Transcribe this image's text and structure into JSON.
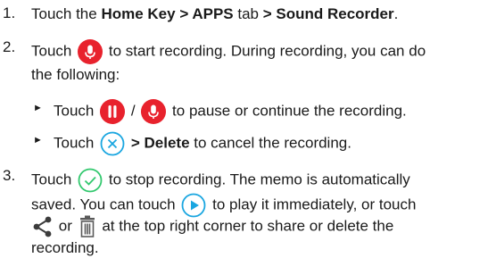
{
  "steps": {
    "s1": {
      "num": "1.",
      "a": "Touch the ",
      "b": "Home Key > APPS",
      "c": " tab ",
      "d": "> Sound Recorder",
      "e": "."
    },
    "s2": {
      "num": "2.",
      "pre": "Touch",
      "post": "to start recording. During recording, you can do",
      "line2": "the following:",
      "sub1": {
        "bullet": "►",
        "pre": "Touch",
        "slash": "/",
        "post": "to pause or continue the recording."
      },
      "sub2": {
        "bullet": "►",
        "pre": "Touch",
        "bold": "> Delete",
        "post": " to cancel the recording."
      }
    },
    "s3": {
      "num": "3.",
      "pre": "Touch",
      "post": "to stop recording. The memo is automatically",
      "l2pre": "saved. You can touch",
      "l2post": "to play it immediately, or touch",
      "l3or": "or",
      "l3post": "at the top right corner to share or delete the",
      "l4": "recording."
    }
  },
  "colors": {
    "record": "#e8222d",
    "green": "#32c86e",
    "blue": "#1aa6e0",
    "share": "#3c3c3c",
    "trash": "#5a5a5a"
  },
  "icons": [
    "record-icon",
    "pause-icon",
    "cancel-icon",
    "stop-check-icon",
    "play-icon",
    "share-icon",
    "delete-trash-icon"
  ]
}
